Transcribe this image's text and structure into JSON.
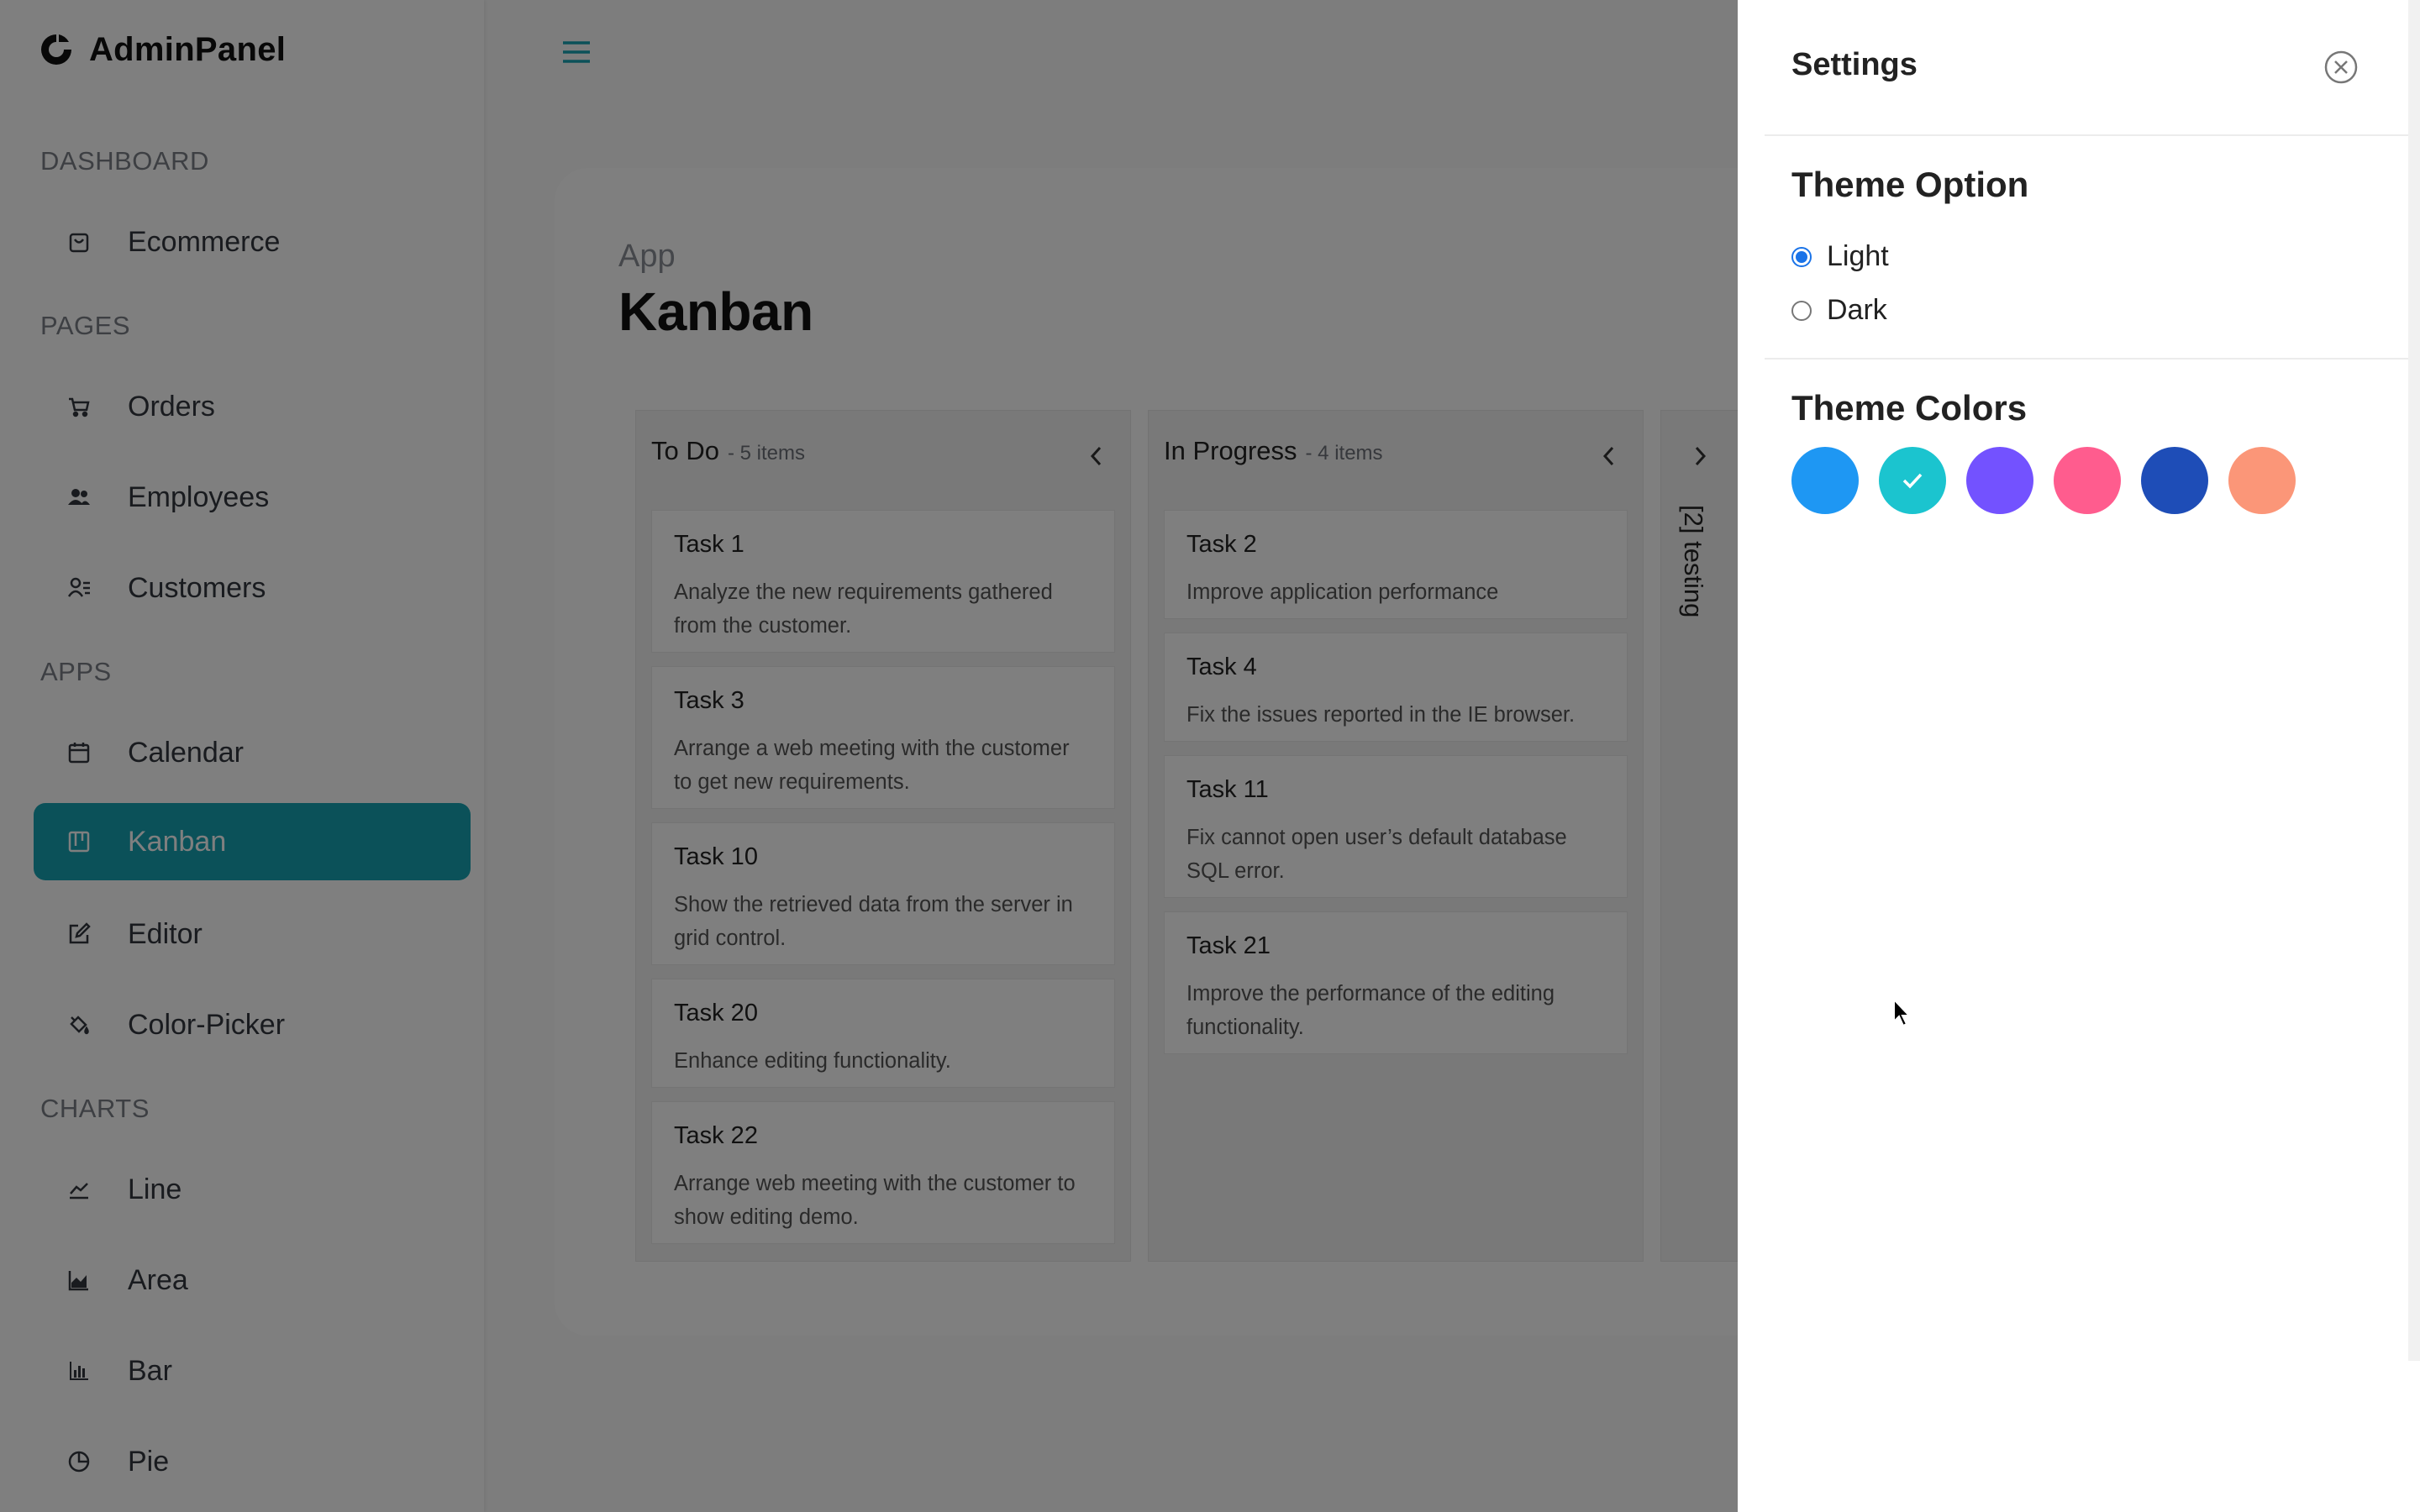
{
  "brand": {
    "name": "AdminPanel"
  },
  "sidebar": {
    "sections": [
      {
        "title": "Dashboard",
        "items": [
          {
            "label": "Ecommerce",
            "icon": "shopping-bag-icon"
          }
        ]
      },
      {
        "title": "Pages",
        "items": [
          {
            "label": "Orders",
            "icon": "cart-icon"
          },
          {
            "label": "Employees",
            "icon": "people-icon"
          },
          {
            "label": "Customers",
            "icon": "contacts-icon"
          }
        ]
      },
      {
        "title": "Apps",
        "items": [
          {
            "label": "Calendar",
            "icon": "calendar-icon"
          },
          {
            "label": "Kanban",
            "icon": "kanban-icon",
            "active": true
          },
          {
            "label": "Editor",
            "icon": "edit-icon"
          },
          {
            "label": "Color-Picker",
            "icon": "paint-bucket-icon"
          }
        ]
      },
      {
        "title": "Charts",
        "items": [
          {
            "label": "Line",
            "icon": "line-chart-icon"
          },
          {
            "label": "Area",
            "icon": "area-chart-icon"
          },
          {
            "label": "Bar",
            "icon": "bar-chart-icon"
          },
          {
            "label": "Pie",
            "icon": "pie-chart-icon"
          }
        ]
      }
    ]
  },
  "header": {
    "breadcrumb": "App",
    "title": "Kanban"
  },
  "kanban": {
    "columns": [
      {
        "title": "To Do",
        "count": "- 5 items",
        "cards": [
          {
            "title": "Task 1",
            "desc": "Analyze the new requirements gathered from the customer."
          },
          {
            "title": "Task 3",
            "desc": "Arrange a web meeting with the customer to get new requirements."
          },
          {
            "title": "Task 10",
            "desc": "Show the retrieved data from the server in grid control."
          },
          {
            "title": "Task 20",
            "desc": "Enhance editing functionality."
          },
          {
            "title": "Task 22",
            "desc": "Arrange web meeting with the customer to show editing demo."
          }
        ]
      },
      {
        "title": "In Progress",
        "count": "- 4 items",
        "cards": [
          {
            "title": "Task 2",
            "desc": "Improve application performance"
          },
          {
            "title": "Task 4",
            "desc": "Fix the issues reported in the IE browser."
          },
          {
            "title": "Task 11",
            "desc": "Fix cannot open user’s default database SQL error."
          },
          {
            "title": "Task 21",
            "desc": "Improve the performance of the editing functionality."
          }
        ]
      }
    ],
    "collapsed_column": {
      "label": "[2] testing"
    }
  },
  "settings": {
    "title": "Settings",
    "theme_option": {
      "heading": "Theme Option",
      "options": [
        "Light",
        "Dark"
      ],
      "selected": "Light"
    },
    "theme_colors": {
      "heading": "Theme Colors",
      "swatches": [
        "#1e97f3",
        "#1bc4cf",
        "#7352ff",
        "#ff5c8e",
        "#1e4db7",
        "#fb9678"
      ],
      "selected_index": 1
    }
  },
  "colors": {
    "accent": "#17a3b2",
    "radio": "#1a73e8"
  }
}
